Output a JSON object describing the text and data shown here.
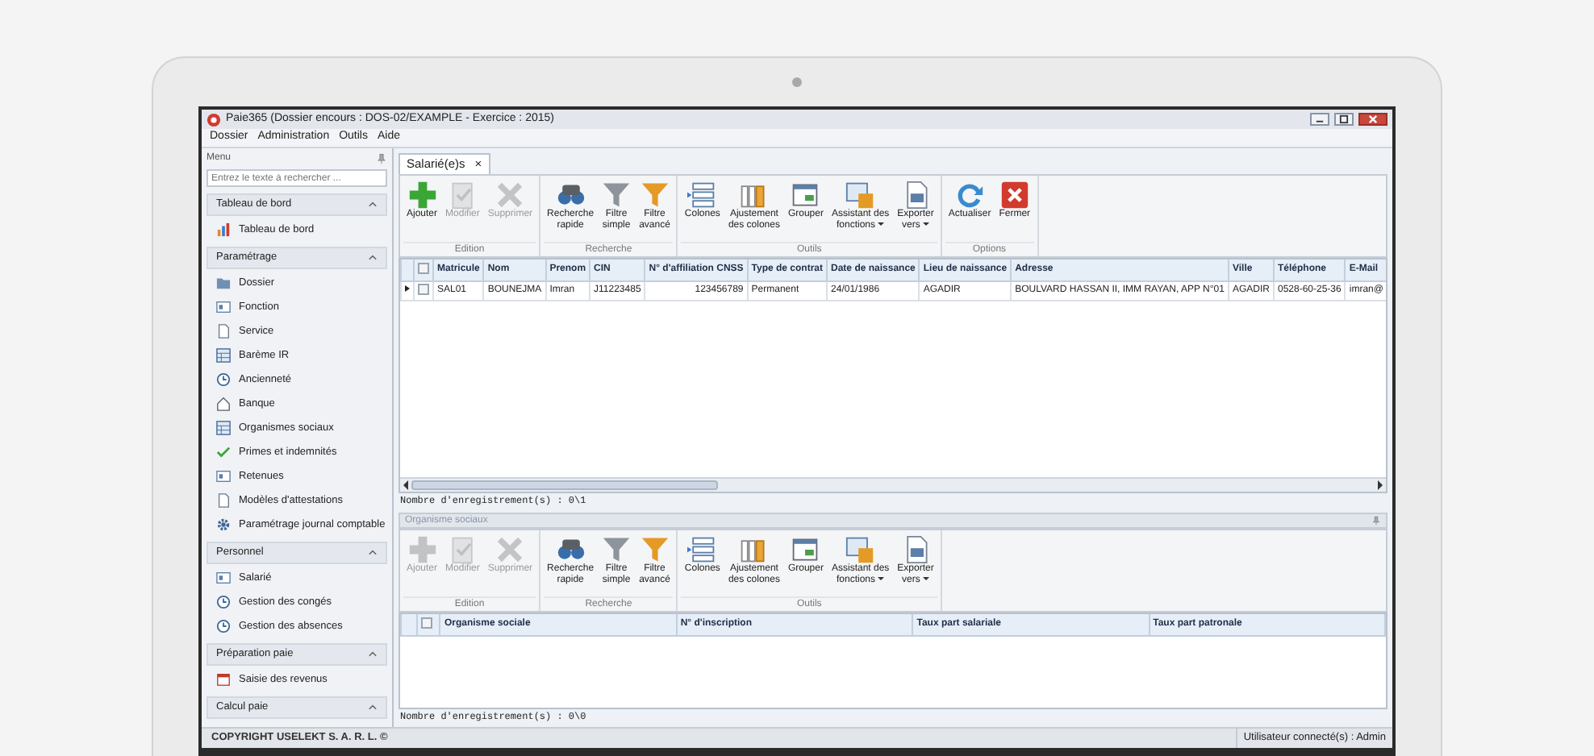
{
  "window": {
    "title": "Paie365 (Dossier encours : DOS-02/EXAMPLE - Exercice : 2015)"
  },
  "menu": [
    {
      "label": "Dossier"
    },
    {
      "label": "Administration"
    },
    {
      "label": "Outils"
    },
    {
      "label": "Aide"
    }
  ],
  "sidebar": {
    "title": "Menu",
    "search": {
      "placeholder": "Entrez le texte à rechercher ..."
    },
    "groups": [
      {
        "label": "Tableau de bord",
        "expanded": true,
        "items": [
          {
            "label": "Tableau de bord",
            "kind": "chart"
          }
        ]
      },
      {
        "label": "Paramétrage",
        "expanded": true,
        "items": [
          {
            "label": "Dossier",
            "kind": "folder"
          },
          {
            "label": "Fonction",
            "kind": "card"
          },
          {
            "label": "Service",
            "kind": "doc"
          },
          {
            "label": "Barème IR",
            "kind": "table"
          },
          {
            "label": "Ancienneté",
            "kind": "clock"
          },
          {
            "label": "Banque",
            "kind": "home"
          },
          {
            "label": "Organismes sociaux",
            "kind": "table"
          },
          {
            "label": "Primes et indemnités",
            "kind": "check"
          },
          {
            "label": "Retenues",
            "kind": "card"
          },
          {
            "label": "Modèles d'attestations",
            "kind": "doc"
          },
          {
            "label": "Paramétrage journal comptable",
            "kind": "gear"
          }
        ]
      },
      {
        "label": "Personnel",
        "expanded": true,
        "items": [
          {
            "label": "Salarié",
            "kind": "card"
          },
          {
            "label": "Gestion des congés",
            "kind": "clock"
          },
          {
            "label": "Gestion des absences",
            "kind": "clock"
          }
        ]
      },
      {
        "label": "Préparation paie",
        "expanded": true,
        "items": [
          {
            "label": "Saisie des revenus",
            "kind": "calendar"
          }
        ]
      },
      {
        "label": "Calcul paie",
        "expanded": true
      }
    ]
  },
  "tabs": [
    {
      "label": "Salarié(e)s",
      "selected": true,
      "close": "×"
    }
  ],
  "ribbon": {
    "groups": [
      {
        "label": "Edition",
        "buttons": [
          {
            "label": "Ajouter",
            "kind": "add",
            "disabled": false
          },
          {
            "label": "Modifier",
            "kind": "edit",
            "disabled": true
          },
          {
            "label": "Supprimer",
            "kind": "delete",
            "disabled": true
          }
        ]
      },
      {
        "label": "Recherche",
        "buttons": [
          {
            "label": "Recherche\nrapide",
            "kind": "search",
            "disabled": false
          },
          {
            "label": "Filtre\nsimple",
            "kind": "filter",
            "disabled": false
          },
          {
            "label": "Filtre\navancé",
            "kind": "filter2",
            "disabled": false
          }
        ]
      },
      {
        "label": "Outils",
        "buttons": [
          {
            "label": "Colones",
            "kind": "columns",
            "disabled": false
          },
          {
            "label": "Ajustement\ndes colones",
            "kind": "fit",
            "disabled": false
          },
          {
            "label": "Grouper",
            "kind": "group",
            "disabled": false
          },
          {
            "label": "Assistant des\nfonctions",
            "kind": "functions",
            "disabled": false,
            "dropdown": true
          },
          {
            "label": "Exporter\nvers",
            "kind": "export",
            "disabled": false,
            "dropdown": true
          }
        ]
      },
      {
        "label": "Options",
        "buttons": [
          {
            "label": "Actualiser",
            "kind": "refresh",
            "disabled": false
          },
          {
            "label": "Fermer",
            "kind": "close",
            "disabled": false
          }
        ]
      }
    ]
  },
  "grid": {
    "select_all": {
      "checked": false
    },
    "columns": [
      "Matricule",
      "Nom",
      "Prenom",
      "CIN",
      "N° d'affiliation CNSS",
      "Type de contrat",
      "Date de naissance",
      "Lieu de naissance",
      "Adresse",
      "Ville",
      "Téléphone",
      "E-Mail"
    ],
    "rows": [
      {
        "selected": true,
        "checked": false,
        "cells": [
          "SAL01",
          "BOUNEJMA",
          "Imran",
          "J11223485",
          "123456789",
          "Permanent",
          "24/01/1986",
          "AGADIR",
          "BOULVARD HASSAN II, IMM RAYAN, APP N°01",
          "AGADIR",
          "0528-60-25-36",
          "imran@"
        ]
      }
    ],
    "record_count": "Nombre d'enregistrement(s) : 0\\1"
  },
  "lower_panel": {
    "title": "Organisme sociaux",
    "ribbon": {
      "groups": [
        {
          "label": "Edition",
          "buttons": [
            {
              "label": "Ajouter",
              "kind": "add",
              "disabled": true
            },
            {
              "label": "Modifier",
              "kind": "edit",
              "disabled": true
            },
            {
              "label": "Supprimer",
              "kind": "delete",
              "disabled": true
            }
          ]
        },
        {
          "label": "Recherche",
          "buttons": [
            {
              "label": "Recherche\nrapide",
              "kind": "search",
              "disabled": false
            },
            {
              "label": "Filtre\nsimple",
              "kind": "filter",
              "disabled": false
            },
            {
              "label": "Filtre\navancé",
              "kind": "filter2",
              "disabled": false
            }
          ]
        },
        {
          "label": "Outils",
          "buttons": [
            {
              "label": "Colones",
              "kind": "columns",
              "disabled": false
            },
            {
              "label": "Ajustement\ndes colones",
              "kind": "fit",
              "disabled": false
            },
            {
              "label": "Grouper",
              "kind": "group",
              "disabled": false
            },
            {
              "label": "Assistant des\nfonctions",
              "kind": "functions",
              "disabled": false,
              "dropdown": true
            },
            {
              "label": "Exporter\nvers",
              "kind": "export",
              "disabled": false,
              "dropdown": true
            }
          ]
        }
      ]
    },
    "grid": {
      "select_all": {
        "checked": false
      },
      "columns": [
        "Organisme sociale",
        "N° d'inscription",
        "Taux part salariale",
        "Taux part patronale"
      ],
      "record_count": "Nombre d'enregistrement(s) : 0\\0"
    }
  },
  "status_bar": {
    "copyright": "COPYRIGHT USELEKT S. A. R. L. ©",
    "user": "Utilisateur connecté(s) : Admin"
  }
}
